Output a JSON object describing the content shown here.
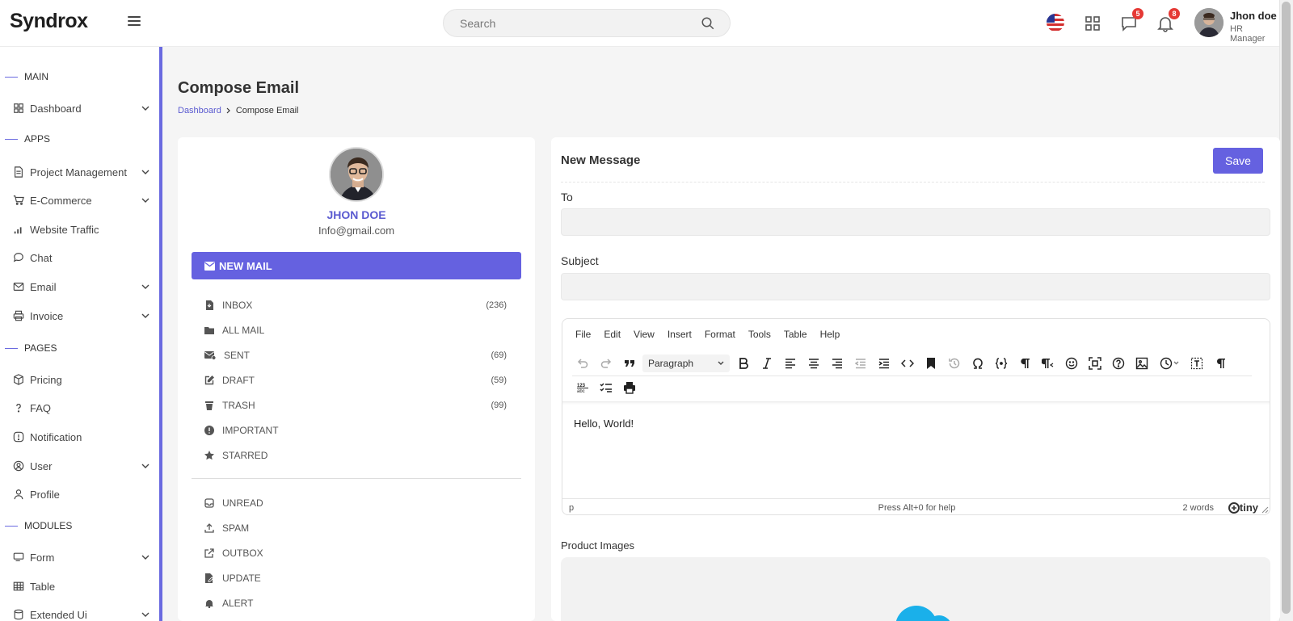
{
  "app": {
    "logo": "Syndrox"
  },
  "header": {
    "search_placeholder": "Search",
    "messages_badge": "5",
    "notifications_badge": "8",
    "user_name": "Jhon doe",
    "user_role": "HR Manager"
  },
  "sidebar": {
    "sections": {
      "main": "MAIN",
      "apps": "APPS",
      "pages": "PAGES",
      "modules": "MODULES"
    },
    "items": {
      "dashboard": "Dashboard",
      "project_management": "Project Management",
      "ecommerce": "E-Commerce",
      "website_traffic": "Website Traffic",
      "chat": "Chat",
      "email": "Email",
      "invoice": "Invoice",
      "pricing": "Pricing",
      "faq": "FAQ",
      "notification": "Notification",
      "user": "User",
      "profile": "Profile",
      "form": "Form",
      "table": "Table",
      "extended_ui": "Extended Ui"
    }
  },
  "page": {
    "title": "Compose Email",
    "breadcrumb": [
      "Dashboard",
      "Compose Email"
    ]
  },
  "mailbox": {
    "profile_name": "JHON DOE",
    "profile_email": "Info@gmail.com",
    "new_mail_label": "NEW MAIL",
    "folders": [
      {
        "label": "INBOX",
        "count": "(236)"
      },
      {
        "label": "ALL MAIL",
        "count": ""
      },
      {
        "label": "SENT",
        "count": "(69)"
      },
      {
        "label": "DRAFT",
        "count": "(59)"
      },
      {
        "label": "TRASH",
        "count": "(99)"
      },
      {
        "label": "IMPORTANT",
        "count": ""
      },
      {
        "label": "STARRED",
        "count": ""
      }
    ],
    "labels": [
      {
        "label": "UNREAD"
      },
      {
        "label": "SPAM"
      },
      {
        "label": "OUTBOX"
      },
      {
        "label": "UPDATE"
      },
      {
        "label": "ALERT"
      }
    ]
  },
  "compose": {
    "title": "New Message",
    "save_label": "Save",
    "to_label": "To",
    "to_value": "",
    "subject_label": "Subject",
    "subject_value": "",
    "editor": {
      "menu": [
        "File",
        "Edit",
        "View",
        "Insert",
        "Format",
        "Tools",
        "Table",
        "Help"
      ],
      "block_format": "Paragraph",
      "content": "Hello, World!",
      "status_path": "p",
      "status_help": "Press Alt+0 for help",
      "word_count": "2 words",
      "brand": "tiny"
    },
    "product_images_label": "Product Images"
  },
  "colors": {
    "accent": "#6561e0",
    "badge": "#e53935"
  }
}
